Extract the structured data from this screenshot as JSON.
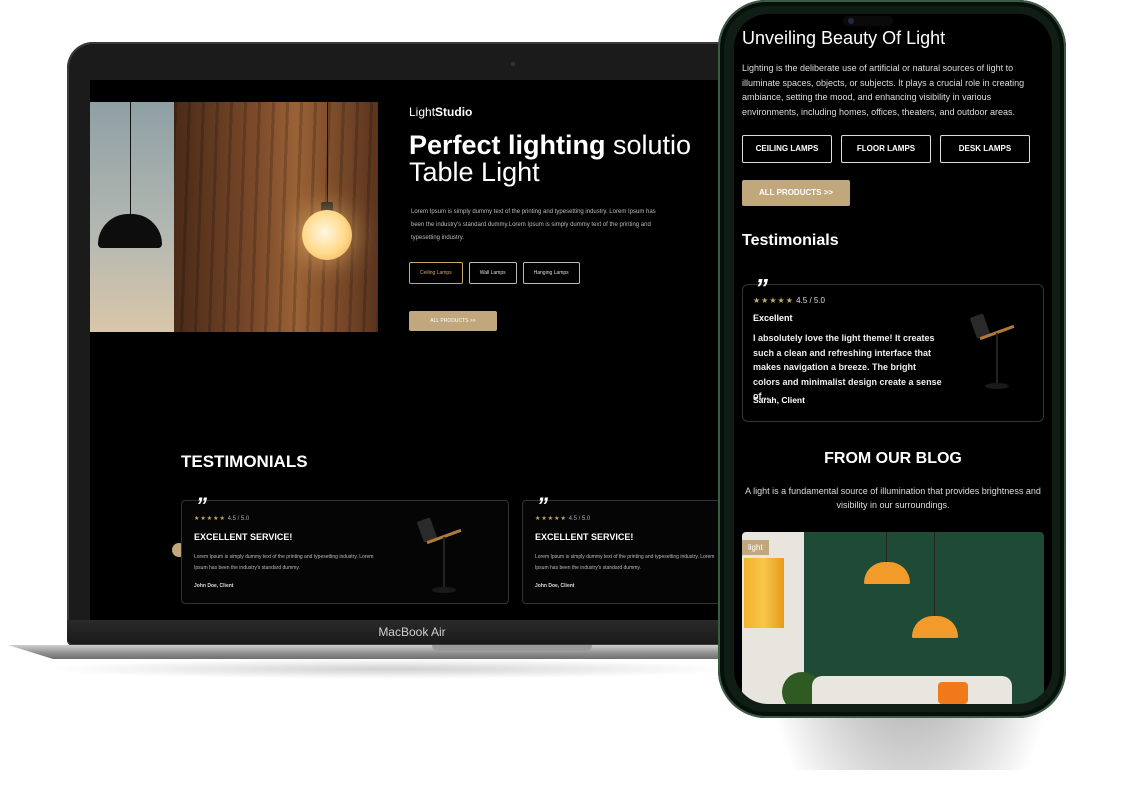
{
  "laptop": {
    "model_label": "MacBook Air",
    "brand_light": "Light",
    "brand_studio": "Studio",
    "hero_title_strong": "Perfect lighting",
    "hero_title_rest": " solutio",
    "hero_title_line2": "Table Light",
    "hero_text": "Lorem Ipsum is simply dummy text of the printing and typesetting industry. Lorem Ipsum has been the industry's standard dummy.Lorem Ipsum is simply dummy text of the printing and typesetting industry.",
    "pills": [
      "Ceiling Lamps",
      "Wall Lamps",
      "Hanging Lamps"
    ],
    "all_products": "ALL PRODUCTS  >>",
    "testimonials_heading": "TESTIMONIALS",
    "cards": [
      {
        "quote": "”",
        "stars": "★★★★★",
        "rating": "4.5 / 5.0",
        "heading": "EXCELLENT SERVICE!",
        "body": "Lorem Ipsum is simply dummy text of the printing and typesetting industry. Lorem Ipsum has been the industry's standard dummy.",
        "author": "John Doe, Client"
      },
      {
        "quote": "”",
        "stars": "★★★★★",
        "rating": "4.5 / 5.0",
        "heading": "EXCELLENT SERVICE!",
        "body": "Lorem Ipsum is simply dummy text of the printing and typesetting industry. Lorem Ipsum has been the industry's standard dummy.",
        "author": "John Doe, Client"
      }
    ]
  },
  "phone": {
    "title": "Unveiling Beauty Of Light",
    "description": "Lighting is the deliberate use of artificial or natural sources of light to illuminate spaces, objects, or subjects. It plays a crucial role in creating ambiance, setting the mood, and enhancing visibility in various environments, including homes, offices, theaters, and outdoor areas.",
    "categories": [
      "CEILING LAMPS",
      "FLOOR LAMPS",
      "DESK LAMPS"
    ],
    "all_products": "ALL PRODUCTS  >>",
    "testimonials_heading": "Testimonials",
    "card": {
      "quote": "”",
      "stars": "★★★★★",
      "rating": "4.5 / 5.0",
      "heading": "Excellent",
      "body": "I absolutely love the light theme! It creates such a clean and refreshing interface that makes navigation a breeze. The bright colors and minimalist design create a sense of...",
      "author": "Sarah, Client"
    },
    "blog_heading": "FROM OUR BLOG",
    "blog_description": "A light is a fundamental source of illumination that provides brightness and visibility in our surroundings.",
    "blog_tag": "light"
  },
  "colors": {
    "accent": "#c1a77c",
    "background": "#000000",
    "phone_frame": "#0f1d14"
  },
  "icons": [
    "quote-icon",
    "star-icon",
    "chevron-right-icon"
  ]
}
